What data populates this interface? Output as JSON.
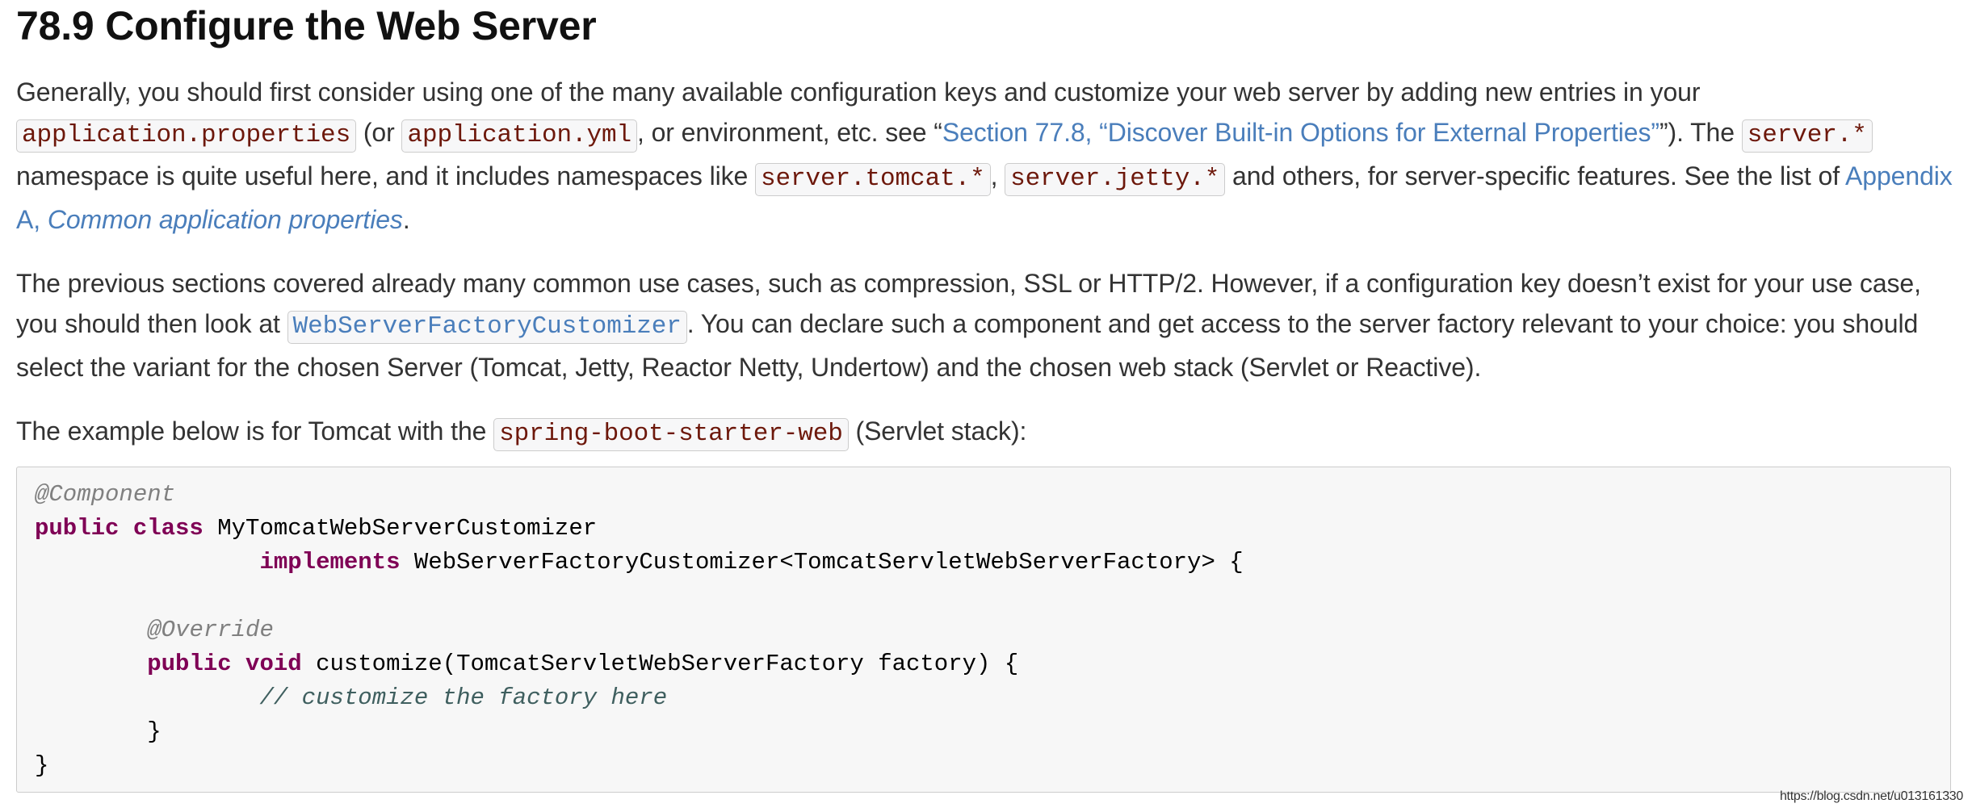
{
  "heading": "78.9 Configure the Web Server",
  "para1": {
    "t1": "Generally, you should first consider using one of the many available configuration keys and customize your web server by adding new entries in your ",
    "code1": "application.properties",
    "t2": " (or ",
    "code2": "application.yml",
    "t3": ", or environment, etc. see “",
    "link1": "Section 77.8, “Discover Built-in Options for External Properties”",
    "t4": "”). The ",
    "code3": "server.*",
    "t5": " namespace is quite useful here, and it includes namespaces like ",
    "code4": "server.tomcat.*",
    "t6": ", ",
    "code5": "server.jetty.*",
    "t7": " and others, for server-specific features. See the list of ",
    "link2_prefix": "Appendix A, ",
    "link2_em": "Common application properties",
    "t8": "."
  },
  "para2": {
    "t1": "The previous sections covered already many common use cases, such as compression, SSL or HTTP/2. However, if a configuration key doesn’t exist for your use case, you should then look at ",
    "code1": "WebServerFactoryCustomizer",
    "t2": ". You can declare such a component and get access to the server factory relevant to your choice: you should select the variant for the chosen Server (Tomcat, Jetty, Reactor Netty, Undertow) and the chosen web stack (Servlet or Reactive)."
  },
  "para3": {
    "t1": "The example below is for Tomcat with the ",
    "code1": "spring-boot-starter-web",
    "t2": " (Servlet stack):"
  },
  "code_block": {
    "l1_anno": "@Component",
    "l2_kw": "public class",
    "l2_rest": " MyTomcatWebServerCustomizer",
    "l3_indent": "                ",
    "l3_kw": "implements",
    "l3_rest": " WebServerFactoryCustomizer<TomcatServletWebServerFactory> {",
    "l5_indent": "        ",
    "l5_anno": "@Override",
    "l6_indent": "        ",
    "l6_kw": "public void",
    "l6_rest": " customize(TomcatServletWebServerFactory factory) {",
    "l7_indent": "                ",
    "l7_cmt": "// customize the factory here",
    "l8": "        }",
    "l9": "}"
  },
  "footer_url": "https://blog.csdn.net/u013161330",
  "colors": {
    "link": "#4a7ebb",
    "literal": "#6d180b",
    "keyword": "#7f0055",
    "annotation": "#808080",
    "comment": "#3f5f5f"
  }
}
